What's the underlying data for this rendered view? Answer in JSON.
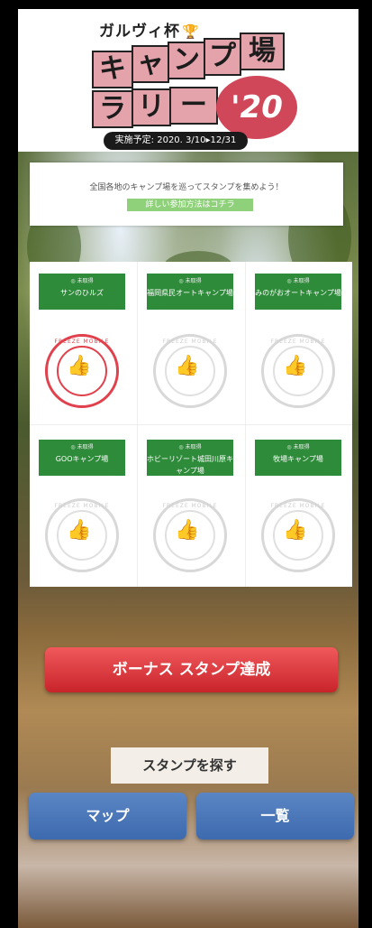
{
  "header": {
    "brand": "ガルヴィ杯",
    "title_line1": [
      "キ",
      "ャ",
      "ン",
      "プ",
      "場"
    ],
    "title_line2": [
      "ラ",
      "リ",
      "ー"
    ],
    "year": "'20",
    "period": "実施予定: 2020. 3/10▸12/31"
  },
  "intro": {
    "text": "全国各地のキャンプ場を巡ってスタンプを集めよう！",
    "link": "詳しい参加方法はコチラ"
  },
  "stamps": [
    {
      "label": "サンのひルズ",
      "collected": true
    },
    {
      "label": "福岡県民オートキャンプ場",
      "collected": false
    },
    {
      "label": "みのがおオートキャンプ場",
      "collected": false
    },
    {
      "label": "GOOキャンプ場",
      "collected": false
    },
    {
      "label": "ホビーリゾート城田川原キャンプ場",
      "collected": false
    },
    {
      "label": "牧場キャンプ場",
      "collected": false
    }
  ],
  "stamp_mark": "FREEZE MOBILE",
  "stamp_label_prefix": "◎ 未取得",
  "buttons": {
    "bonus": "ボーナス スタンプ達成",
    "search": "スタンプを探す",
    "map": "マップ",
    "list": "一覧"
  },
  "colors": {
    "accent_red": "#d9343a",
    "label_green": "#2e8b3a",
    "nav_blue": "#4a78ba"
  }
}
